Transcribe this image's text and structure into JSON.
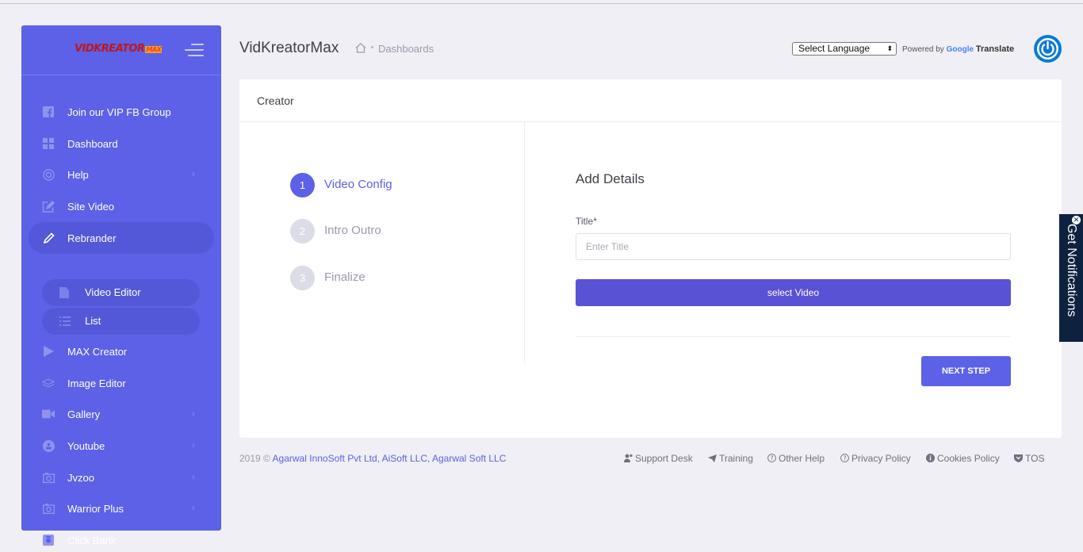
{
  "brand": {
    "logo_text": "VIDKREATOR",
    "logo_suffix": "MAX"
  },
  "sidebar": {
    "items": [
      {
        "label": "Join our VIP FB Group",
        "icon": "facebook-icon"
      },
      {
        "label": "Dashboard",
        "icon": "grid-icon"
      },
      {
        "label": "Help",
        "icon": "lifebuoy-icon",
        "chevron": "›"
      },
      {
        "label": "Site Video",
        "icon": "edit-icon"
      },
      {
        "label": "Rebrander",
        "icon": "pencil-icon"
      },
      {
        "label": "MAX Creator",
        "icon": "play-icon"
      },
      {
        "label": "Image Editor",
        "icon": "layers-icon"
      },
      {
        "label": "Gallery",
        "icon": "video-camera-icon",
        "chevron": "›"
      },
      {
        "label": "Youtube",
        "icon": "youtube-icon",
        "chevron": "›"
      },
      {
        "label": "Jvzoo",
        "icon": "camera-icon",
        "chevron": "›"
      },
      {
        "label": "Warrior Plus",
        "icon": "camera-icon",
        "chevron": "›"
      },
      {
        "label": "Click Bank",
        "icon": "box-icon"
      }
    ],
    "subitems": [
      {
        "label": "Video Editor",
        "icon": "file-icon"
      },
      {
        "label": "List",
        "icon": "list-icon"
      }
    ]
  },
  "header": {
    "app_title": "VidKreatorMax",
    "breadcrumb": "Dashboards",
    "language_select": "Select Language",
    "powered_by": "Powered by",
    "google": "Google",
    "translate": "Translate"
  },
  "panel": {
    "title": "Creator",
    "steps": [
      {
        "num": "1",
        "label": "Video Config"
      },
      {
        "num": "2",
        "label": "Intro Outro"
      },
      {
        "num": "3",
        "label": "Finalize"
      }
    ],
    "form_title": "Add Details",
    "title_label": "Title*",
    "title_placeholder": "Enter Title",
    "select_video": "select Video",
    "next_step": "NEXT STEP"
  },
  "footer": {
    "copyright": "2019 ©",
    "company": "Agarwal InnoSoft Pvt Ltd, AiSoft LLC, Agarwal Soft LLC",
    "links": [
      "Support Desk",
      "Training",
      "Other Help",
      "Privacy Policy",
      "Cookies Policy",
      "TOS"
    ]
  },
  "notifications": {
    "label": "Get Notifications",
    "close": "✕"
  },
  "colors": {
    "accent": "#5c61e7",
    "sidebar": "#5c61e7",
    "button": "#5a52d5",
    "notif": "#0e2240"
  }
}
